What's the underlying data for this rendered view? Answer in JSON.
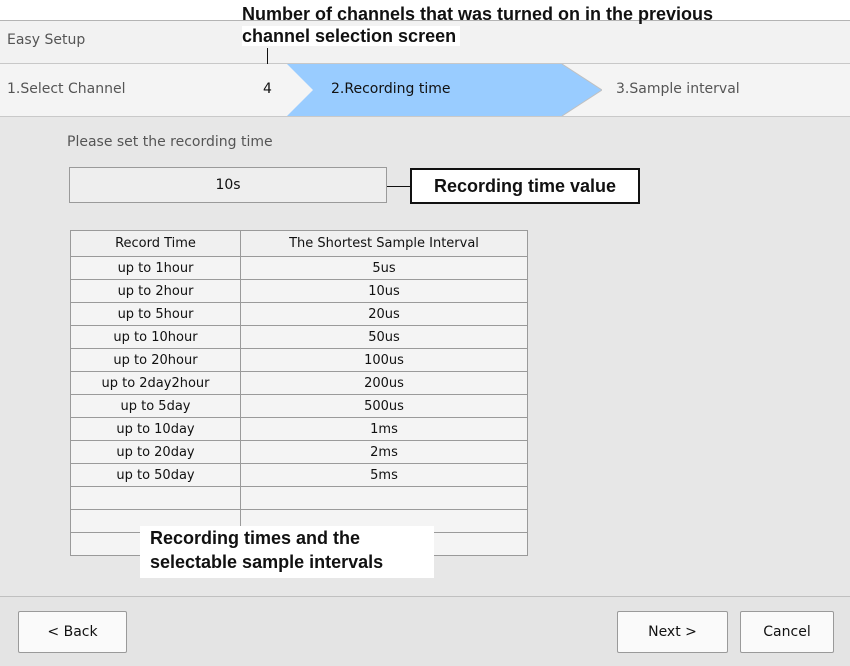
{
  "window": {
    "title": "Easy Setup"
  },
  "steps": {
    "step1": "1.Select Channel",
    "channel_count": "4",
    "step2": "2.Recording time",
    "step3": "3.Sample interval"
  },
  "main": {
    "prompt": "Please set the recording time",
    "recording_time_value": "10s"
  },
  "table": {
    "headers": [
      "Record Time",
      "The Shortest Sample Interval"
    ],
    "rows": [
      [
        "up to 1hour",
        "5us"
      ],
      [
        "up to 2hour",
        "10us"
      ],
      [
        "up to 5hour",
        "20us"
      ],
      [
        "up to 10hour",
        "50us"
      ],
      [
        "up to 20hour",
        "100us"
      ],
      [
        "up to 2day2hour",
        "200us"
      ],
      [
        "up to 5day",
        "500us"
      ],
      [
        "up to 10day",
        "1ms"
      ],
      [
        "up to 20day",
        "2ms"
      ],
      [
        "up to 50day",
        "5ms"
      ],
      [
        "",
        ""
      ],
      [
        "",
        ""
      ],
      [
        "",
        ""
      ]
    ]
  },
  "buttons": {
    "back": "< Back",
    "next": "Next >",
    "cancel": "Cancel"
  },
  "callouts": {
    "channels_line1": "Number of channels that was turned on in the previous",
    "channels_line2": "channel selection screen",
    "recording_value": "Recording time value",
    "table_line1": "Recording times and the",
    "table_line2": "selectable sample intervals"
  },
  "colors": {
    "active_step": "#99ccff",
    "dialog_bg": "#e7e7e7"
  }
}
